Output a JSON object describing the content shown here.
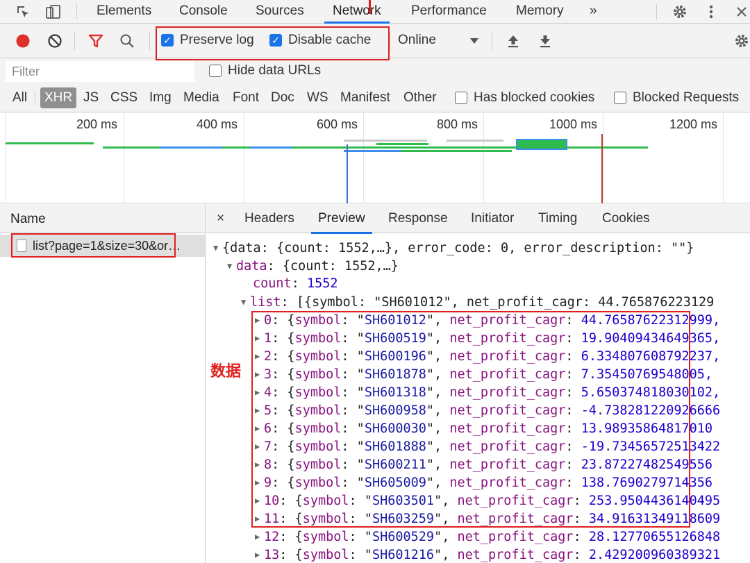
{
  "tabbar": {
    "tabs": [
      "Elements",
      "Console",
      "Sources",
      "Network",
      "Performance",
      "Memory"
    ],
    "more": "»",
    "icons": [
      "inspect-cursor-icon",
      "device-toggle-icon",
      "gear-icon",
      "kebab-menu-icon",
      "close-icon"
    ]
  },
  "toolbar": {
    "preserve_log": "Preserve log",
    "disable_cache": "Disable cache",
    "throttle": "Online",
    "icons": [
      "record-icon",
      "clear-icon",
      "filter-icon",
      "search-icon",
      "upload-icon",
      "download-icon",
      "gear-icon"
    ]
  },
  "filter": {
    "placeholder": "Filter",
    "hide_data_urls": "Hide data URLs",
    "types": [
      "All",
      "XHR",
      "JS",
      "CSS",
      "Img",
      "Media",
      "Font",
      "Doc",
      "WS",
      "Manifest",
      "Other"
    ],
    "selected_type": "XHR",
    "has_blocked_cookies": "Has blocked cookies",
    "blocked_requests": "Blocked Requests"
  },
  "overview": {
    "ticks": [
      "200 ms",
      "400 ms",
      "600 ms",
      "800 ms",
      "1000 ms",
      "1200 ms"
    ]
  },
  "requests": {
    "header": "Name",
    "rows": [
      "list?page=1&size=30&or…"
    ]
  },
  "detail": {
    "close": "×",
    "tabs": [
      "Headers",
      "Preview",
      "Response",
      "Initiator",
      "Timing",
      "Cookies"
    ],
    "active": "Preview"
  },
  "preview": {
    "root_summary": "{data: {count: 1552,…}, error_code: 0, error_description: \"\"}",
    "data_key": "data",
    "data_summary": "{count: 1552,…}",
    "count_key": "count",
    "count_value": "1552",
    "list_key": "list",
    "list_summary": "[{symbol: \"SH601012\", net_profit_cagr: 44.765876223129",
    "items": [
      {
        "index": "0",
        "symbol": "SH601012",
        "cagr": "44.76587622312999,"
      },
      {
        "index": "1",
        "symbol": "SH600519",
        "cagr": "19.90409434649365,"
      },
      {
        "index": "2",
        "symbol": "SH600196",
        "cagr": "6.334807608792237,"
      },
      {
        "index": "3",
        "symbol": "SH601878",
        "cagr": "7.35450769548005,"
      },
      {
        "index": "4",
        "symbol": "SH601318",
        "cagr": "5.650374818030102,"
      },
      {
        "index": "5",
        "symbol": "SH600958",
        "cagr": "-4.738281220926666"
      },
      {
        "index": "6",
        "symbol": "SH600030",
        "cagr": "13.98935864817010"
      },
      {
        "index": "7",
        "symbol": "SH601888",
        "cagr": "-19.73456572513422"
      },
      {
        "index": "8",
        "symbol": "SH600211",
        "cagr": "23.87227482549556"
      },
      {
        "index": "9",
        "symbol": "SH605009",
        "cagr": "138.7690279714356"
      },
      {
        "index": "10",
        "symbol": "SH603501",
        "cagr": "253.9504436140495"
      },
      {
        "index": "11",
        "symbol": "SH603259",
        "cagr": "34.91631349118609"
      },
      {
        "index": "12",
        "symbol": "SH600529",
        "cagr": "28.12770655126848"
      },
      {
        "index": "13",
        "symbol": "SH601216",
        "cagr": "2.429200960389321"
      }
    ]
  },
  "annotation": {
    "label": "数据",
    "color": "#e02020"
  },
  "colors": {
    "accent": "#1a73e8",
    "record": "#e0302a",
    "waterfall_green": "#2fbc4e",
    "waterfall_blue": "#3b8df0"
  }
}
